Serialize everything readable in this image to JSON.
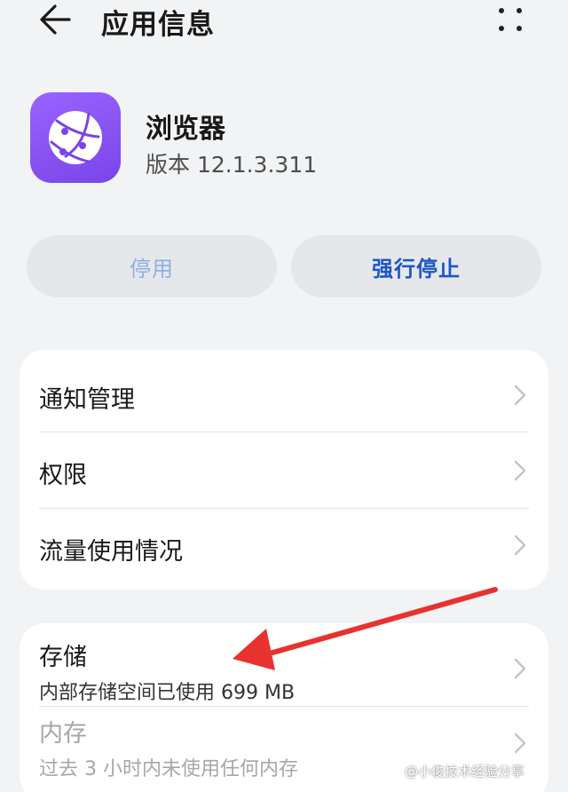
{
  "header": {
    "title": "应用信息",
    "back_icon": "arrow-left-icon",
    "more_icon": "more-vertical-icon"
  },
  "app": {
    "name": "浏览器",
    "version": "版本 12.1.3.311",
    "icon": "browser-globe-icon",
    "icon_color": "#8b55f5"
  },
  "actions": {
    "disable_label": "停用",
    "force_stop_label": "强行停止"
  },
  "settings": [
    {
      "label": "通知管理"
    },
    {
      "label": "权限"
    },
    {
      "label": "流量使用情况"
    }
  ],
  "storage": {
    "label": "存储",
    "detail": "内部存储空间已使用 699 MB"
  },
  "memory": {
    "label": "内存",
    "detail": "过去 3 小时内未使用任何内存"
  },
  "annotation": {
    "arrow_color": "#e8322e"
  },
  "watermark": "@小俊技术经验分享"
}
